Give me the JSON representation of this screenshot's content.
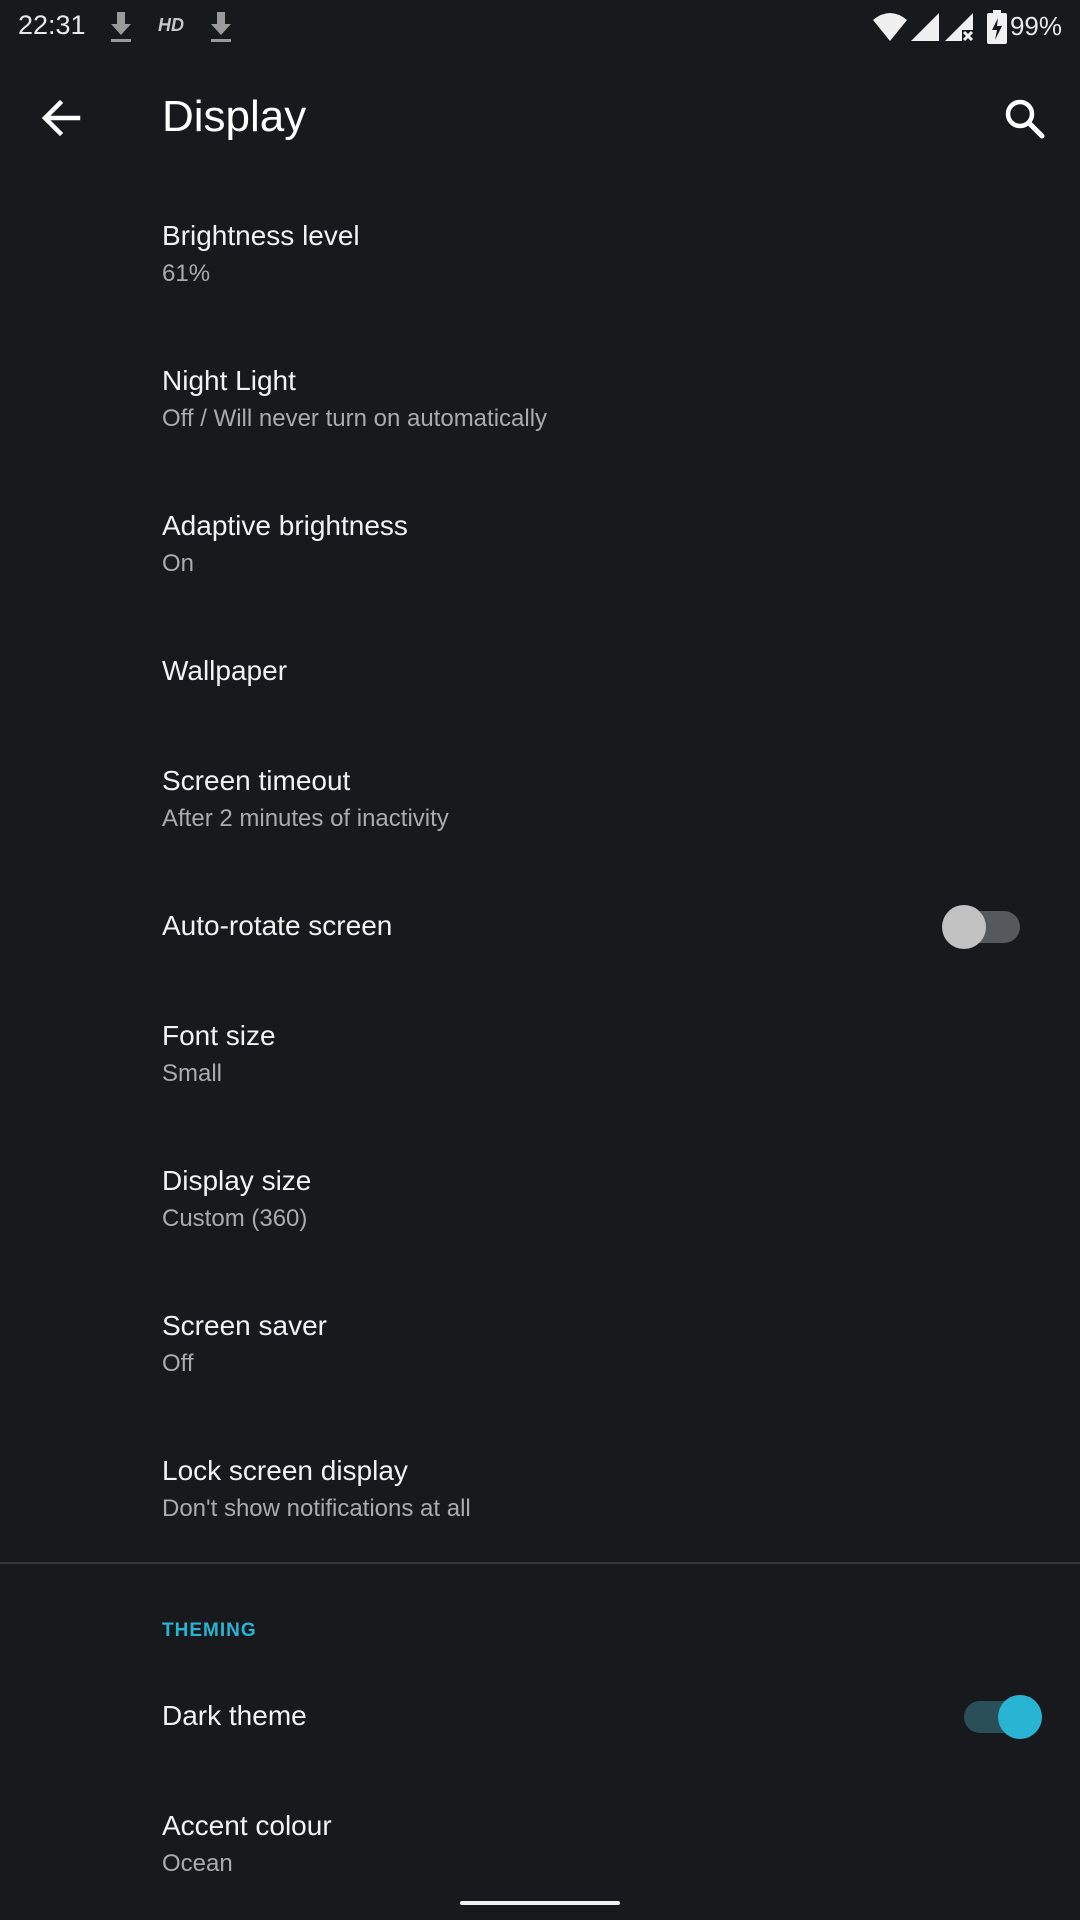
{
  "status_bar": {
    "time": "22:31",
    "hd_label": "HD",
    "battery": "99%",
    "icons": [
      "download-icon",
      "hd-icon",
      "download-icon",
      "wifi-icon",
      "signal-icon",
      "signal-no-data-icon",
      "battery-charging-icon"
    ]
  },
  "app_bar": {
    "title": "Display",
    "back_icon": "arrow-back-icon",
    "search_icon": "search-icon"
  },
  "settings": [
    {
      "title": "Brightness level",
      "summary": "61%"
    },
    {
      "title": "Night Light",
      "summary": "Off / Will never turn on automatically"
    },
    {
      "title": "Adaptive brightness",
      "summary": "On"
    },
    {
      "title": "Wallpaper",
      "summary": ""
    },
    {
      "title": "Screen timeout",
      "summary": "After 2 minutes of inactivity"
    },
    {
      "title": "Auto-rotate screen",
      "summary": "",
      "toggle": false
    },
    {
      "title": "Font size",
      "summary": "Small"
    },
    {
      "title": "Display size",
      "summary": "Custom (360)"
    },
    {
      "title": "Screen saver",
      "summary": "Off"
    },
    {
      "title": "Lock screen display",
      "summary": "Don't show notifications at all"
    }
  ],
  "theming": {
    "header": "THEMING",
    "items": [
      {
        "title": "Dark theme",
        "summary": "",
        "toggle": true
      },
      {
        "title": "Accent colour",
        "summary": "Ocean"
      }
    ]
  },
  "colors": {
    "background": "#18191c",
    "accent": "#2ab4d4",
    "primary_text": "#f2f2f2",
    "secondary_text": "#a9abae"
  }
}
